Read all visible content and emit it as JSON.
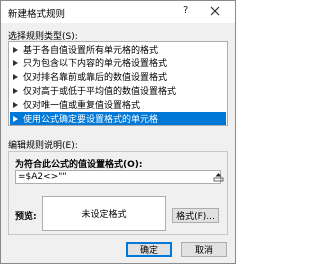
{
  "window": {
    "title": "新建格式规则",
    "help_label": "?"
  },
  "rule_type": {
    "label": "选择规则类型(S):",
    "items": [
      {
        "label": "基于各自值设置所有单元格的格式",
        "selected": false
      },
      {
        "label": "只为包含以下内容的单元格设置格式",
        "selected": false
      },
      {
        "label": "仅对排名靠前或靠后的数值设置格式",
        "selected": false
      },
      {
        "label": "仅对高于或低于平均值的数值设置格式",
        "selected": false
      },
      {
        "label": "仅对唯一值或重复值设置格式",
        "selected": false
      },
      {
        "label": "使用公式确定要设置格式的单元格",
        "selected": true
      }
    ]
  },
  "rule_desc": {
    "label": "编辑规则说明(E):",
    "formula_label": "为符合此公式的值设置格式(O):",
    "formula_value": "=$A2<>\"\"",
    "preview_label": "预览:",
    "preview_text": "未设定格式",
    "format_button": "格式(F)..."
  },
  "buttons": {
    "ok": "确定",
    "cancel": "取消"
  },
  "colors": {
    "selection": "#0078d7",
    "dialog_bg": "#f0f0f0"
  }
}
